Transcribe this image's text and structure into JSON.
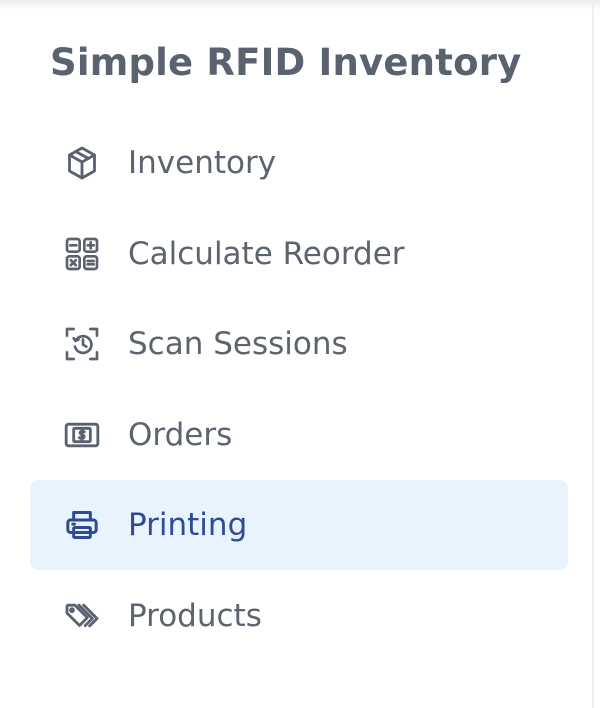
{
  "sidebar": {
    "title": "Simple RFID Inventory",
    "active_index": 4,
    "colors": {
      "text": "#5d6470",
      "title": "#5a6270",
      "active_text": "#304b96",
      "active_bg": "#e8f3fe"
    },
    "items": [
      {
        "label": "Inventory",
        "icon": "cube-icon"
      },
      {
        "label": "Calculate Reorder",
        "icon": "calculator-icon"
      },
      {
        "label": "Scan Sessions",
        "icon": "scan-history-icon"
      },
      {
        "label": "Orders",
        "icon": "dollar-bill-icon"
      },
      {
        "label": "Printing",
        "icon": "printer-icon"
      },
      {
        "label": "Products",
        "icon": "tags-icon"
      }
    ]
  }
}
